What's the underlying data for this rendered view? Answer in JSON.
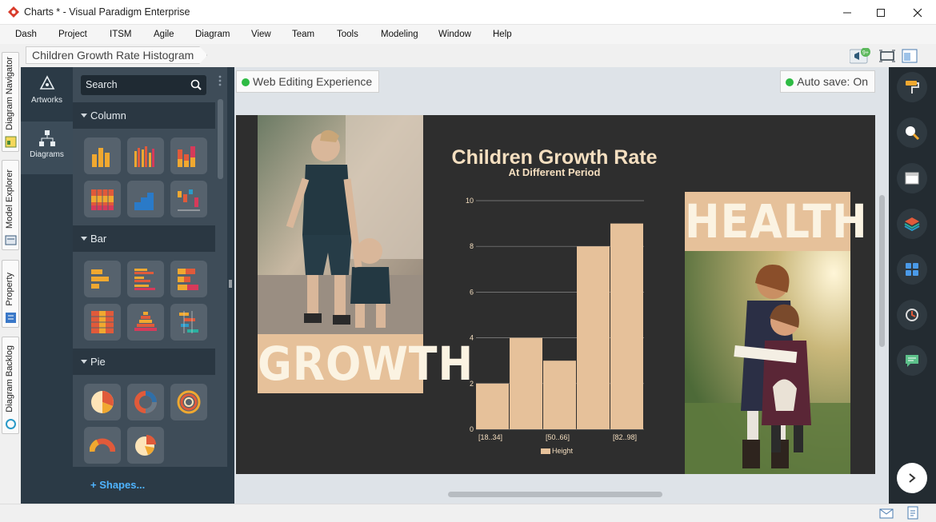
{
  "window": {
    "title": "Charts * - Visual Paradigm Enterprise",
    "buttons": [
      "minimize",
      "maximize",
      "close"
    ]
  },
  "menu": [
    "Dash",
    "Project",
    "ITSM",
    "Agile",
    "Diagram",
    "View",
    "Team",
    "Tools",
    "Modeling",
    "Window",
    "Help"
  ],
  "breadcrumb": "Children Growth Rate Histogram",
  "toolbar": {
    "notification_badge": "9+"
  },
  "left_tabs": [
    "Diagram Navigator",
    "Model Explorer",
    "Property",
    "Diagram Backlog"
  ],
  "rail": {
    "artworks": "Artworks",
    "diagrams": "Diagrams"
  },
  "shape_panel": {
    "search_placeholder": "Search",
    "sections": [
      {
        "label": "Column"
      },
      {
        "label": "Bar"
      },
      {
        "label": "Pie"
      }
    ],
    "shapes_link": "+ Shapes..."
  },
  "canvas": {
    "web_edit": "Web Editing Experience",
    "autosave": "Auto save: On"
  },
  "design": {
    "word_left": "GROWTH",
    "word_right": "HEALTH"
  },
  "chart_data": {
    "type": "bar",
    "title": "Children Growth Rate",
    "subtitle": "At Different Period",
    "categories": [
      "[18..34]",
      "",
      "",
      "[50..66]",
      "",
      "[82..98]"
    ],
    "tick_labels_x": [
      "[18..34]",
      "[50..66]",
      "[82..98]"
    ],
    "values": [
      2,
      4,
      3,
      8,
      9
    ],
    "ylim": [
      0,
      10
    ],
    "yticks": [
      "0",
      "2",
      "4",
      "6",
      "8",
      "10"
    ],
    "legend": "Height",
    "legend_position": "bottom",
    "bar_color": "#e6c19a",
    "grid": true
  },
  "right_tools": [
    "format-painter-icon",
    "search-icon",
    "window-icon",
    "layers-icon",
    "panels-icon",
    "history-icon",
    "comment-icon"
  ]
}
